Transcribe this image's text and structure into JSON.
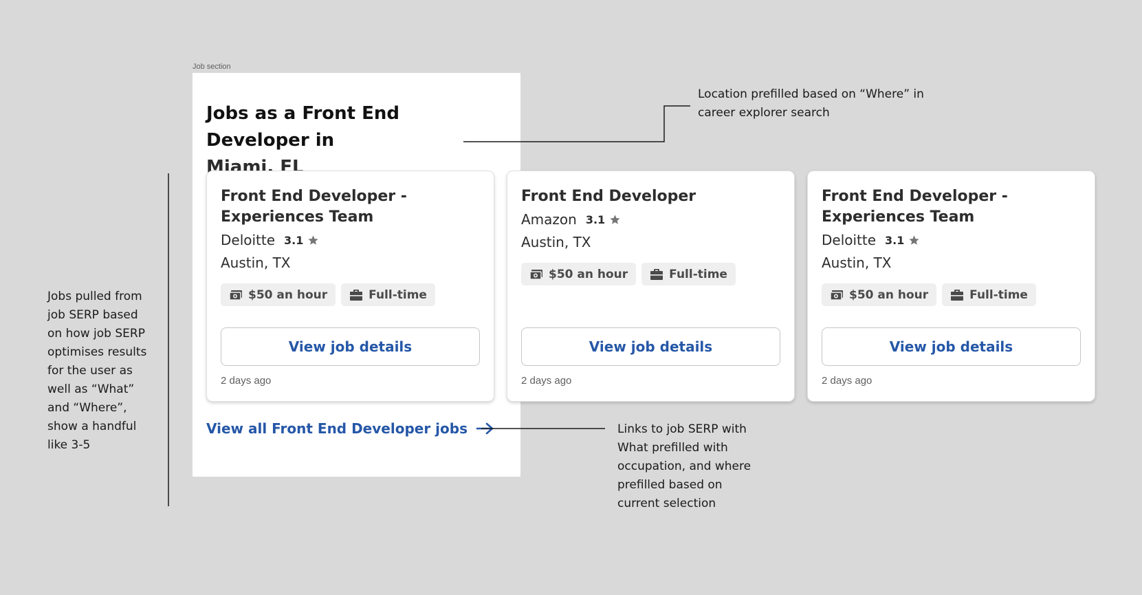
{
  "frame_label": "Job section",
  "section": {
    "title": "Jobs as a Front End Developer in",
    "location": "Miami, FL"
  },
  "cards": [
    {
      "title": "Front End Developer - Experiences Team",
      "company": "Deloitte",
      "rating": "3.1",
      "location": "Austin, TX",
      "pay": "$50 an hour",
      "job_type": "Full-time",
      "button": "View job details",
      "posted": "2 days ago"
    },
    {
      "title": "Front End Developer",
      "company": "Amazon",
      "rating": "3.1",
      "location": "Austin, TX",
      "pay": "$50 an hour",
      "job_type": "Full-time",
      "button": "View job details",
      "posted": "2 days ago"
    },
    {
      "title": "Front End Developer - Experiences Team",
      "company": "Deloitte",
      "rating": "3.1",
      "location": "Austin, TX",
      "pay": "$50 an hour",
      "job_type": "Full-time",
      "button": "View job details",
      "posted": "2 days ago"
    }
  ],
  "view_all_link": "View all Front End Developer jobs",
  "annotations": {
    "location_note": "Location prefilled based on “Where” in career explorer search",
    "jobs_note": "Jobs pulled from job SERP based on how job SERP optimises results for the user as well as “What” and “Where”, show a handful like 3-5",
    "link_note": "Links to job SERP with What prefilled with occupation, and where prefilled based on current selection"
  },
  "icons": {
    "star": "star-icon",
    "pay": "money-icon",
    "job_type": "briefcase-icon",
    "link": "arrow-right-icon"
  },
  "colors": {
    "background": "#d9d9d9",
    "link": "#2557a7",
    "tag_bg": "#efefef",
    "text": "#2d2d2d"
  }
}
